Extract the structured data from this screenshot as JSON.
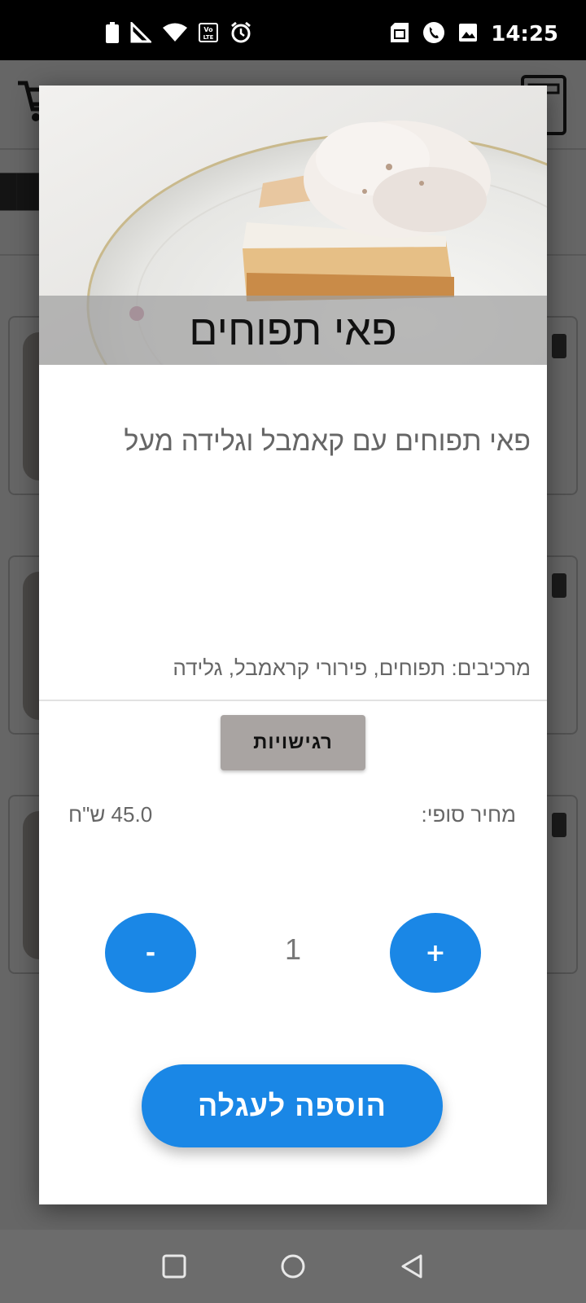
{
  "status_bar": {
    "time": "14:25",
    "left_icons": [
      "battery-icon",
      "signal-icon",
      "wifi-icon",
      "volte-icon",
      "alarm-icon"
    ],
    "right_icons": [
      "sim-icon",
      "phone-icon",
      "image-icon"
    ],
    "volte_label": "Vo LTE"
  },
  "dialog": {
    "title": "פאי תפוחים",
    "description": "פאי תפוחים עם קאמבל וגלידה מעל",
    "ingredients": "מרכיבים: תפוחים, פירורי קראמבל, גלידה",
    "allergies_button": "רגישויות",
    "price_label": "מחיר סופי:",
    "price_value": "45.0 ש\"ח",
    "quantity": "1",
    "minus_label": "-",
    "plus_label": "+",
    "add_to_cart": "הוספה לעגלה"
  },
  "colors": {
    "accent": "#1a87e6",
    "allergy_button": "#a9a4a2",
    "text_gray": "#666666"
  },
  "nav_bar": [
    "recents-icon",
    "home-icon",
    "back-icon"
  ]
}
